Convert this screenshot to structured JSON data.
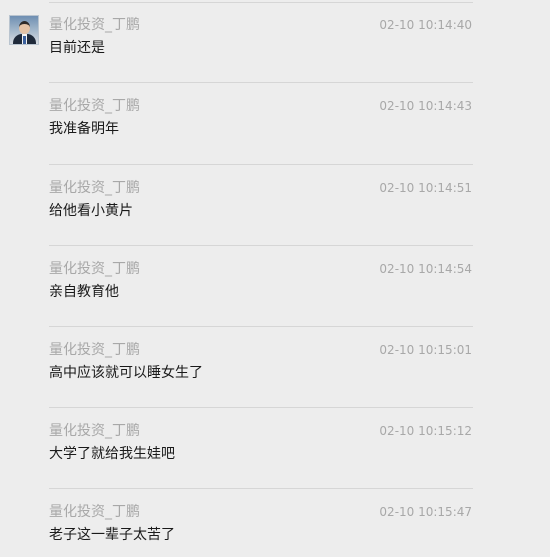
{
  "messages": [
    {
      "sender": "量化投资_丁鹏",
      "time": "02-10 10:14:40",
      "text": "目前还是"
    },
    {
      "sender": "量化投资_丁鹏",
      "time": "02-10 10:14:43",
      "text": "我准备明年"
    },
    {
      "sender": "量化投资_丁鹏",
      "time": "02-10 10:14:51",
      "text": "给他看小黄片"
    },
    {
      "sender": "量化投资_丁鹏",
      "time": "02-10 10:14:54",
      "text": "亲自教育他"
    },
    {
      "sender": "量化投资_丁鹏",
      "time": "02-10 10:15:01",
      "text": "高中应该就可以睡女生了"
    },
    {
      "sender": "量化投资_丁鹏",
      "time": "02-10 10:15:12",
      "text": "大学了就给我生娃吧"
    },
    {
      "sender": "量化投资_丁鹏",
      "time": "02-10 10:15:47",
      "text": "老子这一辈子太苦了"
    }
  ]
}
